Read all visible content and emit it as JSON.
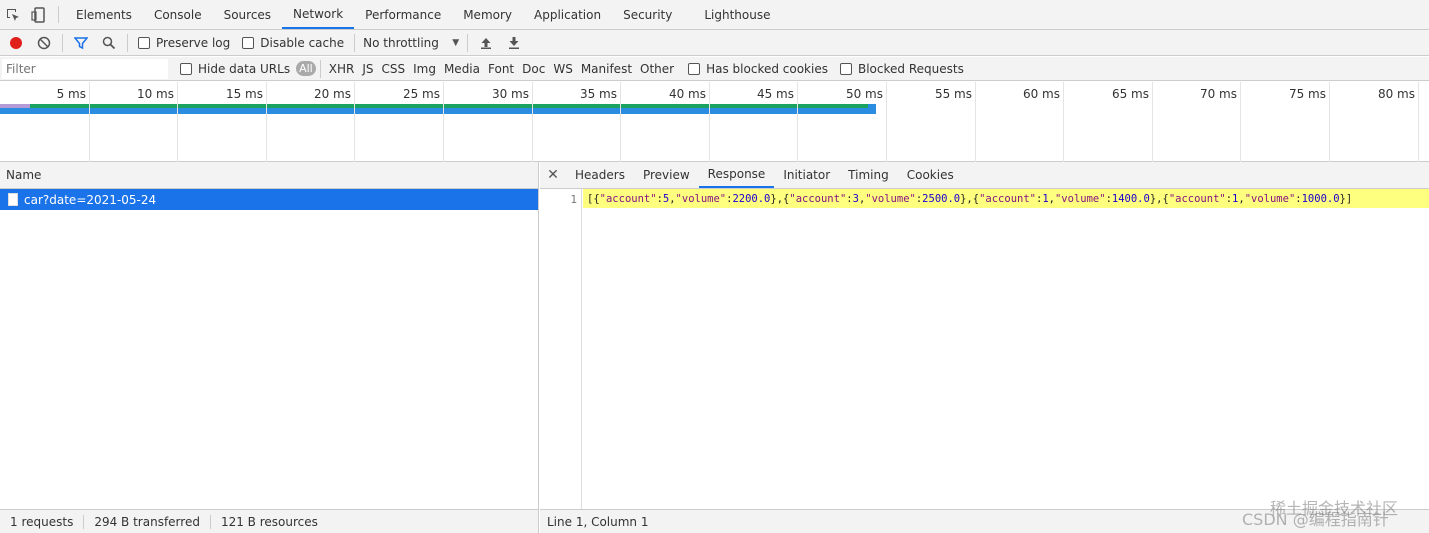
{
  "main_tabs": [
    {
      "label": "Elements"
    },
    {
      "label": "Console"
    },
    {
      "label": "Sources"
    },
    {
      "label": "Network",
      "active": true
    },
    {
      "label": "Performance"
    },
    {
      "label": "Memory"
    },
    {
      "label": "Application"
    },
    {
      "label": "Security"
    },
    {
      "label": "Lighthouse"
    }
  ],
  "toolbar": {
    "preserve_log": "Preserve log",
    "disable_cache": "Disable cache",
    "throttling": "No throttling"
  },
  "filter": {
    "placeholder": "Filter",
    "hide_data_urls": "Hide data URLs",
    "types": [
      "All",
      "XHR",
      "JS",
      "CSS",
      "Img",
      "Media",
      "Font",
      "Doc",
      "WS",
      "Manifest",
      "Other"
    ],
    "has_blocked_cookies": "Has blocked cookies",
    "blocked_requests": "Blocked Requests"
  },
  "timeline": {
    "ticks": [
      "5 ms",
      "10 ms",
      "15 ms",
      "20 ms",
      "25 ms",
      "30 ms",
      "35 ms",
      "40 ms",
      "45 ms",
      "50 ms",
      "55 ms",
      "60 ms",
      "65 ms",
      "70 ms",
      "75 ms",
      "80 ms"
    ]
  },
  "requests": {
    "column_name": "Name",
    "items": [
      {
        "name": "car?date=2021-05-24"
      }
    ]
  },
  "detail": {
    "tabs": [
      "Headers",
      "Preview",
      "Response",
      "Initiator",
      "Timing",
      "Cookies"
    ],
    "active_tab": "Response",
    "line_number": "1",
    "response": [
      {
        "account": "5",
        "volume": "2200.0"
      },
      {
        "account": "3",
        "volume": "2500.0"
      },
      {
        "account": "1",
        "volume": "1400.0"
      },
      {
        "account": "1",
        "volume": "1000.0"
      }
    ],
    "cursor": "Line 1, Column 1"
  },
  "status": {
    "requests": "1 requests",
    "transferred": "294 B transferred",
    "resources": "121 B resources"
  },
  "watermarks": [
    "稀土掘金技术社区",
    "CSDN @编程指南针"
  ],
  "colors": {
    "accent": "#1a73e8",
    "record": "#e0201b",
    "highlight": "#ffff7f"
  }
}
